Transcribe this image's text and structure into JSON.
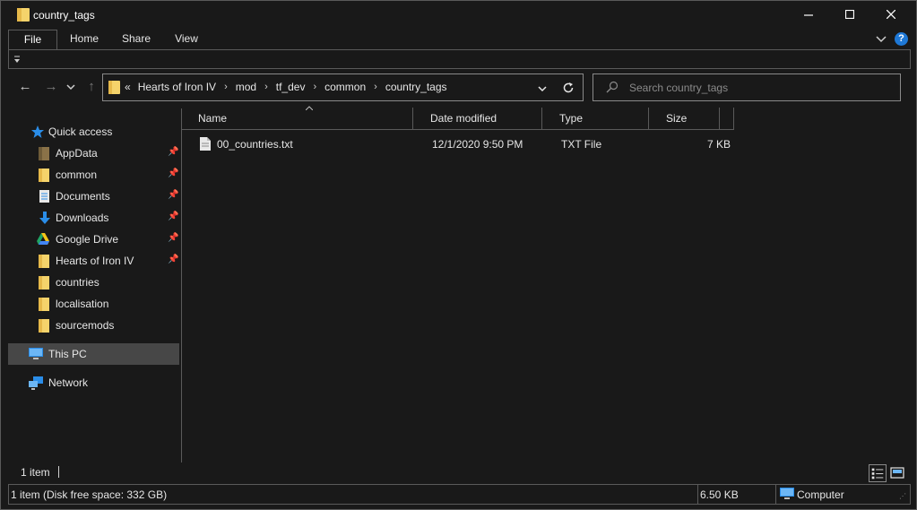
{
  "window": {
    "title": "country_tags",
    "minimize_label": "−",
    "maximize_label": "☐",
    "close_label": "✕"
  },
  "ribbon": {
    "tabs": [
      "File",
      "Home",
      "Share",
      "View"
    ],
    "expand_icon": "chevron-down-icon",
    "help_label": "?"
  },
  "nav": {
    "back": "←",
    "forward": "→",
    "recent": "⌄",
    "up": "↑"
  },
  "address": {
    "overflow": "«",
    "crumbs": [
      "Hearts of Iron IV",
      "mod",
      "tf_dev",
      "common",
      "country_tags"
    ]
  },
  "search": {
    "placeholder": "Search country_tags"
  },
  "sidebar": {
    "quick_access": "Quick access",
    "items": [
      {
        "label": "AppData",
        "icon": "folder-icon",
        "pinned": true
      },
      {
        "label": "common",
        "icon": "folder-icon",
        "pinned": true
      },
      {
        "label": "Documents",
        "icon": "documents-icon",
        "pinned": true
      },
      {
        "label": "Downloads",
        "icon": "download-icon",
        "pinned": true
      },
      {
        "label": "Google Drive",
        "icon": "google-drive-icon",
        "pinned": true
      },
      {
        "label": "Hearts of Iron IV",
        "icon": "folder-icon",
        "pinned": true
      },
      {
        "label": "countries",
        "icon": "folder-icon",
        "pinned": false
      },
      {
        "label": "localisation",
        "icon": "folder-icon",
        "pinned": false
      },
      {
        "label": "sourcemods",
        "icon": "folder-icon",
        "pinned": false
      }
    ],
    "this_pc": "This PC",
    "network": "Network"
  },
  "columns": {
    "name": "Name",
    "date": "Date modified",
    "type": "Type",
    "size": "Size"
  },
  "files": [
    {
      "name": "00_countries.txt",
      "date": "12/1/2020 9:50 PM",
      "type": "TXT File",
      "size": "7 KB"
    }
  ],
  "status": {
    "item_count": "1 item",
    "disk_info": "1 item (Disk free space: 332 GB)",
    "selection_size": "6.50 KB",
    "location": "Computer"
  },
  "colors": {
    "background": "#191919",
    "border": "#5a5a5a",
    "folder": "#f5d36b",
    "accent": "#1e78d6",
    "selected": "#474747"
  }
}
